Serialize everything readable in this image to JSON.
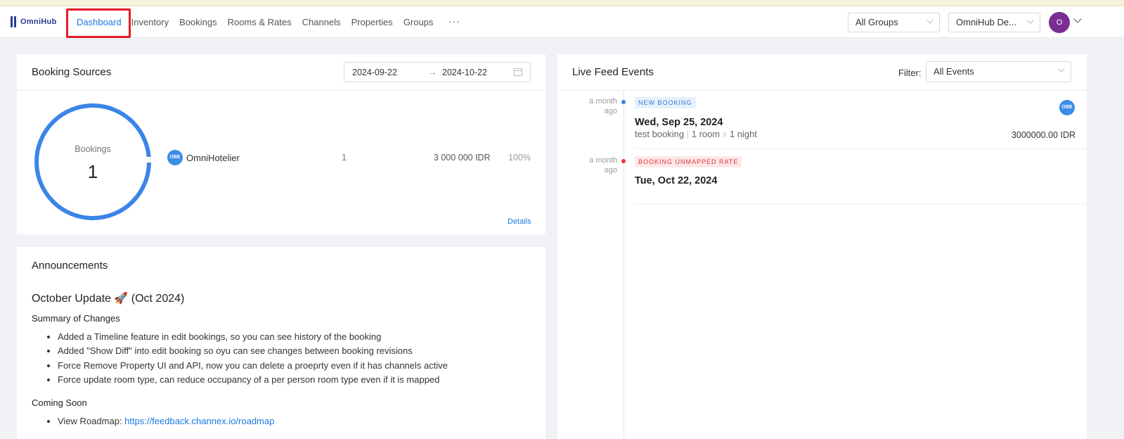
{
  "app": {
    "logo_text": "OmniHub"
  },
  "nav": {
    "items": [
      "Dashboard",
      "Inventory",
      "Bookings",
      "Rooms & Rates",
      "Channels",
      "Properties",
      "Groups"
    ],
    "more": "···"
  },
  "header": {
    "group_select": "All Groups",
    "property_select": "OmniHub De...",
    "avatar_initial": "O"
  },
  "booking_sources": {
    "title": "Booking Sources",
    "date_from": "2024-09-22",
    "date_to": "2024-10-22",
    "arrow": "→",
    "donut_label": "Bookings",
    "donut_value": "1",
    "source": {
      "badge": "OBE",
      "name": "OmniHotelier",
      "count": "1",
      "amount": "3 000 000 IDR",
      "percent": "100%"
    },
    "details_link": "Details",
    "accent_color": "#3b85e7"
  },
  "announcements": {
    "title": "Announcements",
    "update_title": "October Update 🚀 (Oct 2024)",
    "summary_heading": "Summary of Changes",
    "changes": [
      "Added a Timeline feature in edit bookings, so you can see history of the booking",
      "Added \"Show Diff\" into edit booking so oyu can see changes between booking revisions",
      "Force Remove Property UI and API, now you can delete a proeprty even if it has channels active",
      "Force update room type, can reduce occupancy of a per person room type even if it is mapped"
    ],
    "coming_heading": "Coming Soon",
    "roadmap_label": "View Roadmap: ",
    "roadmap_link": "https://feedback.channex.io/roadmap"
  },
  "live_feed": {
    "title": "Live Feed Events",
    "filter_label": "Filter:",
    "filter_value": "All Events",
    "events": [
      {
        "time_line1": "a month",
        "time_line2": "ago",
        "tag": "NEW BOOKING",
        "date": "Wed, Sep 25, 2024",
        "desc_name": "test booking",
        "desc_rooms": "1 room",
        "desc_x": "x",
        "desc_nights": "1 night",
        "amount": "3000000.00 IDR",
        "badge": "OBE",
        "dot_color": "#3b85e7"
      },
      {
        "time_line1": "a month",
        "time_line2": "ago",
        "tag": "BOOKING UNMAPPED RATE",
        "date": "Tue, Oct 22, 2024",
        "dot_color": "#e0363e"
      }
    ]
  }
}
